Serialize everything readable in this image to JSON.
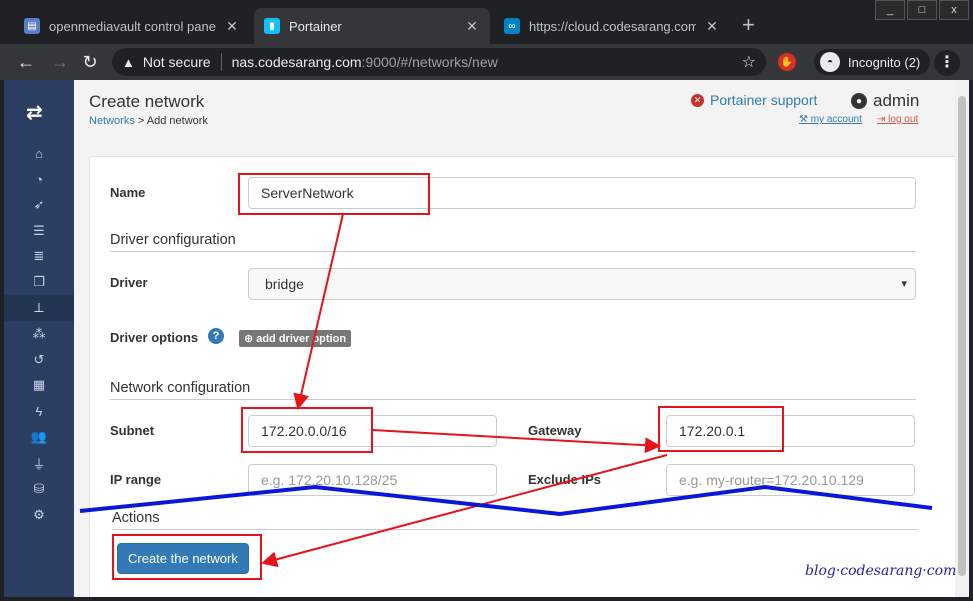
{
  "browser": {
    "tabs": [
      {
        "title": "openmediavault control panel - c",
        "favicon_color": "#5b7fc7",
        "active": false
      },
      {
        "title": "Portainer",
        "favicon_color": "#13bef9",
        "active": true
      },
      {
        "title": "https://cloud.codesarang.com",
        "favicon_color": "#0082c9",
        "active": false
      }
    ],
    "window_controls": [
      "_",
      "□",
      "x"
    ],
    "security_label": "Not secure",
    "url_host": "nas.codesarang.com",
    "url_path": ":9000/#/networks/new",
    "incognito_label": "Incognito (2)"
  },
  "sidebar": {
    "logo_glyph": "⇄",
    "icons": [
      "home-icon",
      "dashboard-icon",
      "rocket-icon",
      "list-icon",
      "server-icon",
      "clone-icon",
      "sitemap-icon",
      "cubes-icon",
      "history-icon",
      "grid-icon",
      "bolt-icon",
      "users-icon",
      "plug-icon",
      "database-icon",
      "cogs-icon"
    ],
    "glyphs": [
      "⌂",
      "◔",
      "➶",
      "☰",
      "≣",
      "❐",
      "⊥",
      "⁂",
      "↺",
      "▦",
      "ϟ",
      "👥",
      "⏚",
      "⛁",
      "⚙"
    ],
    "active_index": 6
  },
  "header": {
    "title": "Create network",
    "breadcrumb_link": "Networks",
    "breadcrumb_rest": " > Add network",
    "support_label": "Portainer support",
    "user_name": "admin",
    "my_account": "my account",
    "log_out": "log out"
  },
  "form": {
    "name_label": "Name",
    "name_value": "ServerNetwork",
    "driver_config_title": "Driver configuration",
    "driver_label": "Driver",
    "driver_value": "bridge",
    "driver_options_label": "Driver options",
    "add_driver_option": "add driver option",
    "network_config_title": "Network configuration",
    "subnet_label": "Subnet",
    "subnet_value": "172.20.0.0/16",
    "gateway_label": "Gateway",
    "gateway_value": "172.20.0.1",
    "ip_range_label": "IP range",
    "ip_range_placeholder": "e.g. 172.20.10.128/25",
    "exclude_ips_label": "Exclude IPs",
    "exclude_ips_placeholder": "e.g. my-router=172.20.10.129",
    "actions_title": "Actions",
    "create_button": "Create the network"
  },
  "annotation": {
    "watermark": "blog·codesarang·com",
    "highlight_color": "#e8121b",
    "tear_line_color": "#0b17d8"
  }
}
